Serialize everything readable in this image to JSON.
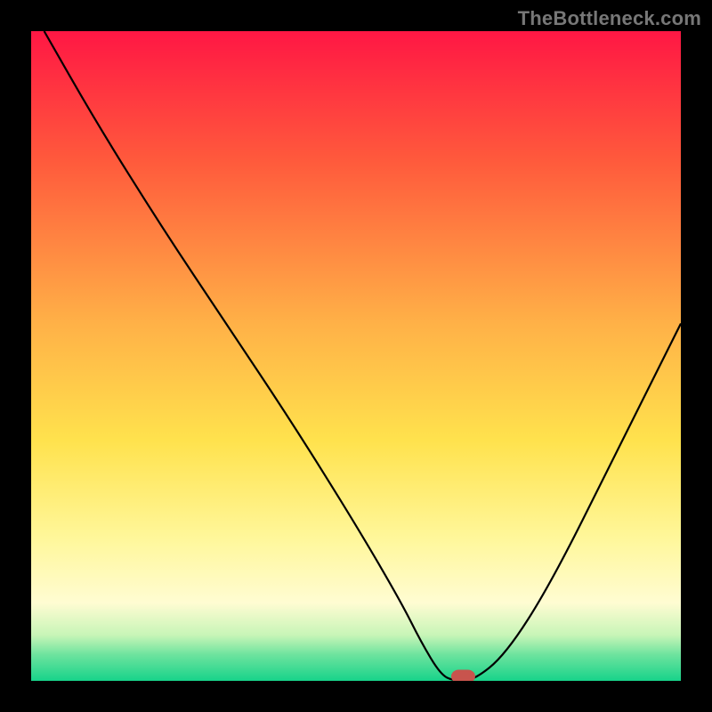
{
  "watermark": "TheBottleneck.com",
  "chart_data": {
    "type": "line",
    "title": "",
    "xlabel": "",
    "ylabel": "",
    "xlim": [
      0,
      100
    ],
    "ylim": [
      0,
      100
    ],
    "x": [
      2,
      10,
      20,
      30,
      40,
      50,
      57,
      60,
      63,
      65,
      68,
      73,
      80,
      90,
      100
    ],
    "y": [
      100,
      86,
      70,
      55,
      40,
      24,
      12,
      6,
      1,
      0,
      0,
      4,
      15,
      35,
      55
    ],
    "marker": {
      "x": 66.5,
      "y": 0
    },
    "background_gradient_stops": [
      {
        "offset": 0,
        "color": "#ff1744"
      },
      {
        "offset": 20,
        "color": "#ff5a3c"
      },
      {
        "offset": 45,
        "color": "#ffb147"
      },
      {
        "offset": 63,
        "color": "#ffe24d"
      },
      {
        "offset": 78,
        "color": "#fff79a"
      },
      {
        "offset": 88,
        "color": "#fffcd2"
      },
      {
        "offset": 93,
        "color": "#c7f5b7"
      },
      {
        "offset": 96,
        "color": "#6de39e"
      },
      {
        "offset": 100,
        "color": "#17d38a"
      }
    ]
  }
}
